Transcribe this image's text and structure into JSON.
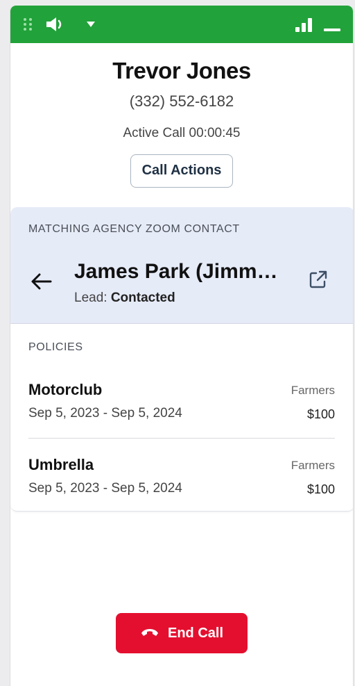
{
  "titlebar": {
    "color": "#22a23a",
    "icons": [
      "drag-handle-icon",
      "speaker-icon",
      "chevron-down-icon",
      "signal-strength-icon",
      "minimize-icon"
    ]
  },
  "caller": {
    "name": "Trevor Jones",
    "phone": "(332) 552-6182",
    "status": "Active Call 00:00:45",
    "actions_label": "Call Actions"
  },
  "contact": {
    "section_label": "MATCHING AGENCY ZOOM CONTACT",
    "name": "James Park (Jimm…",
    "lead_prefix": "Lead:",
    "lead_status": "Contacted",
    "background": "#e6ebf8"
  },
  "policies": {
    "label": "POLICIES",
    "items": [
      {
        "name": "Motorclub",
        "dates": "Sep 5, 2023 - Sep 5, 2024",
        "carrier": "Farmers",
        "amount": "$100"
      },
      {
        "name": "Umbrella",
        "dates": "Sep 5, 2023 - Sep 5, 2024",
        "carrier": "Farmers",
        "amount": "$100"
      }
    ]
  },
  "end_call": {
    "label": "End Call",
    "color": "#e40f2f",
    "icon": "hang-up-phone-icon"
  }
}
